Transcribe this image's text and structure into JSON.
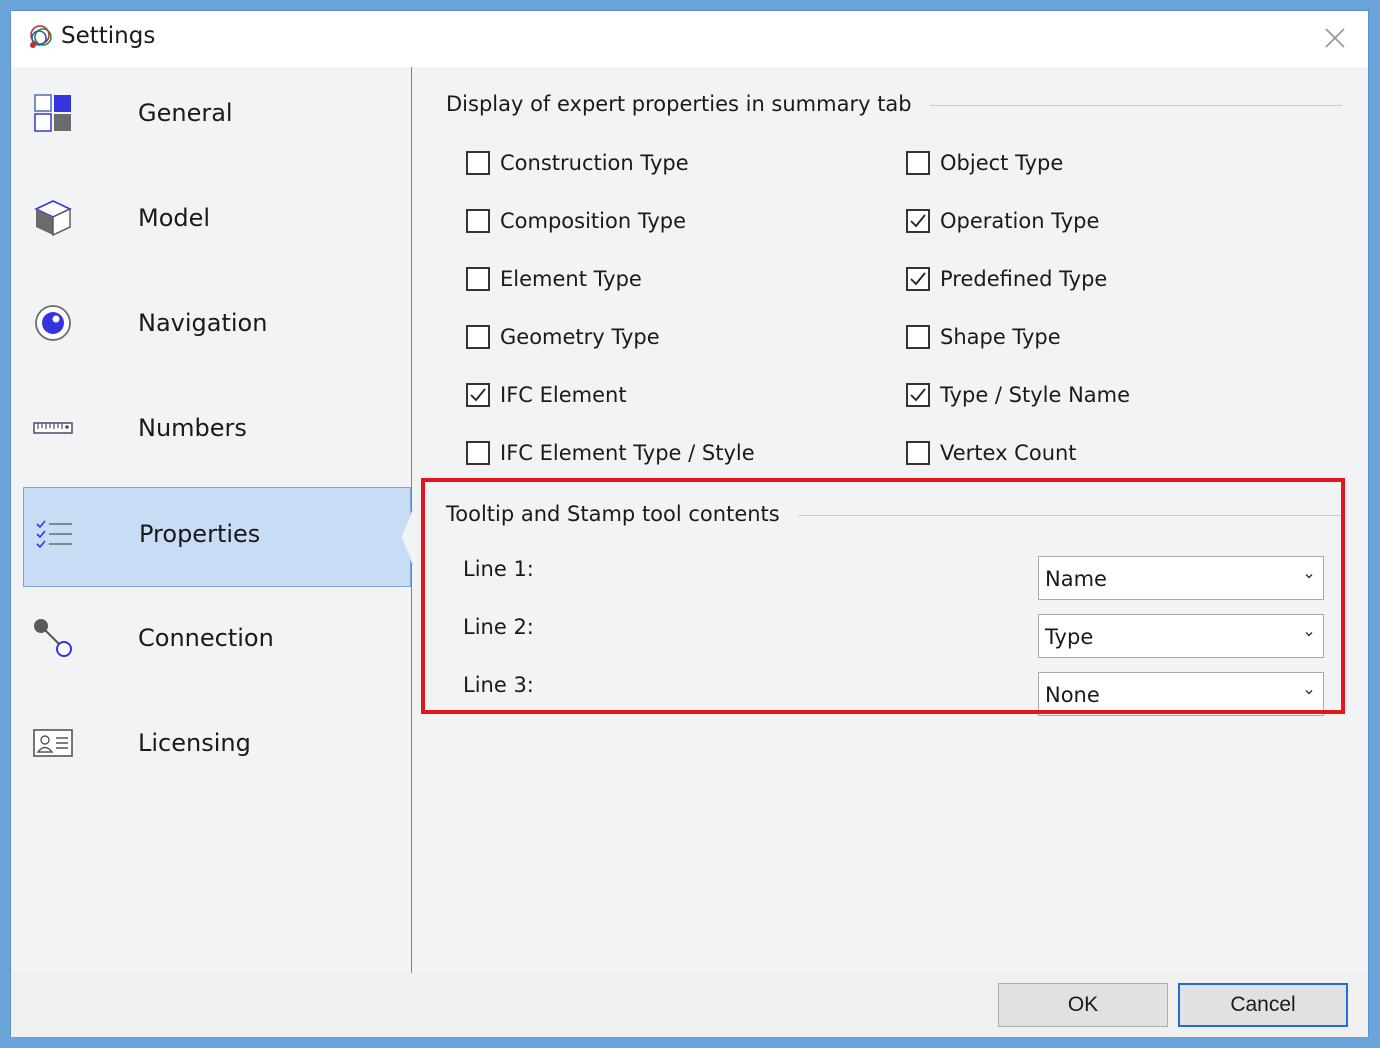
{
  "window": {
    "title": "Settings"
  },
  "sidebar": {
    "items": [
      {
        "label": "General",
        "icon": "general-grid-icon",
        "active": false
      },
      {
        "label": "Model",
        "icon": "cube-icon",
        "active": false
      },
      {
        "label": "Navigation",
        "icon": "navigation-icon",
        "active": false
      },
      {
        "label": "Numbers",
        "icon": "ruler-icon",
        "active": false
      },
      {
        "label": "Properties",
        "icon": "checklist-icon",
        "active": true
      },
      {
        "label": "Connection",
        "icon": "connection-icon",
        "active": false
      },
      {
        "label": "Licensing",
        "icon": "license-card-icon",
        "active": false
      }
    ]
  },
  "expert_properties": {
    "title": "Display of expert properties in summary tab",
    "left": [
      {
        "label": "Construction Type",
        "checked": false
      },
      {
        "label": "Composition Type",
        "checked": false
      },
      {
        "label": "Element Type",
        "checked": false
      },
      {
        "label": "Geometry Type",
        "checked": false
      },
      {
        "label": "IFC Element",
        "checked": true
      },
      {
        "label": "IFC Element Type / Style",
        "checked": false
      }
    ],
    "right": [
      {
        "label": "Object Type",
        "checked": false
      },
      {
        "label": "Operation Type",
        "checked": true
      },
      {
        "label": "Predefined Type",
        "checked": true
      },
      {
        "label": "Shape Type",
        "checked": false
      },
      {
        "label": "Type / Style Name",
        "checked": true
      },
      {
        "label": "Vertex Count",
        "checked": false
      }
    ]
  },
  "tooltip": {
    "title": "Tooltip and Stamp tool contents",
    "lines": [
      {
        "label": "Line 1:",
        "value": "Name"
      },
      {
        "label": "Line 2:",
        "value": "Type"
      },
      {
        "label": "Line 3:",
        "value": "None"
      }
    ]
  },
  "footer": {
    "ok_label": "OK",
    "cancel_label": "Cancel"
  },
  "colors": {
    "accent": "#3b3bdc",
    "highlight": "#e0171d",
    "active_bg": "#c8ddf5"
  }
}
